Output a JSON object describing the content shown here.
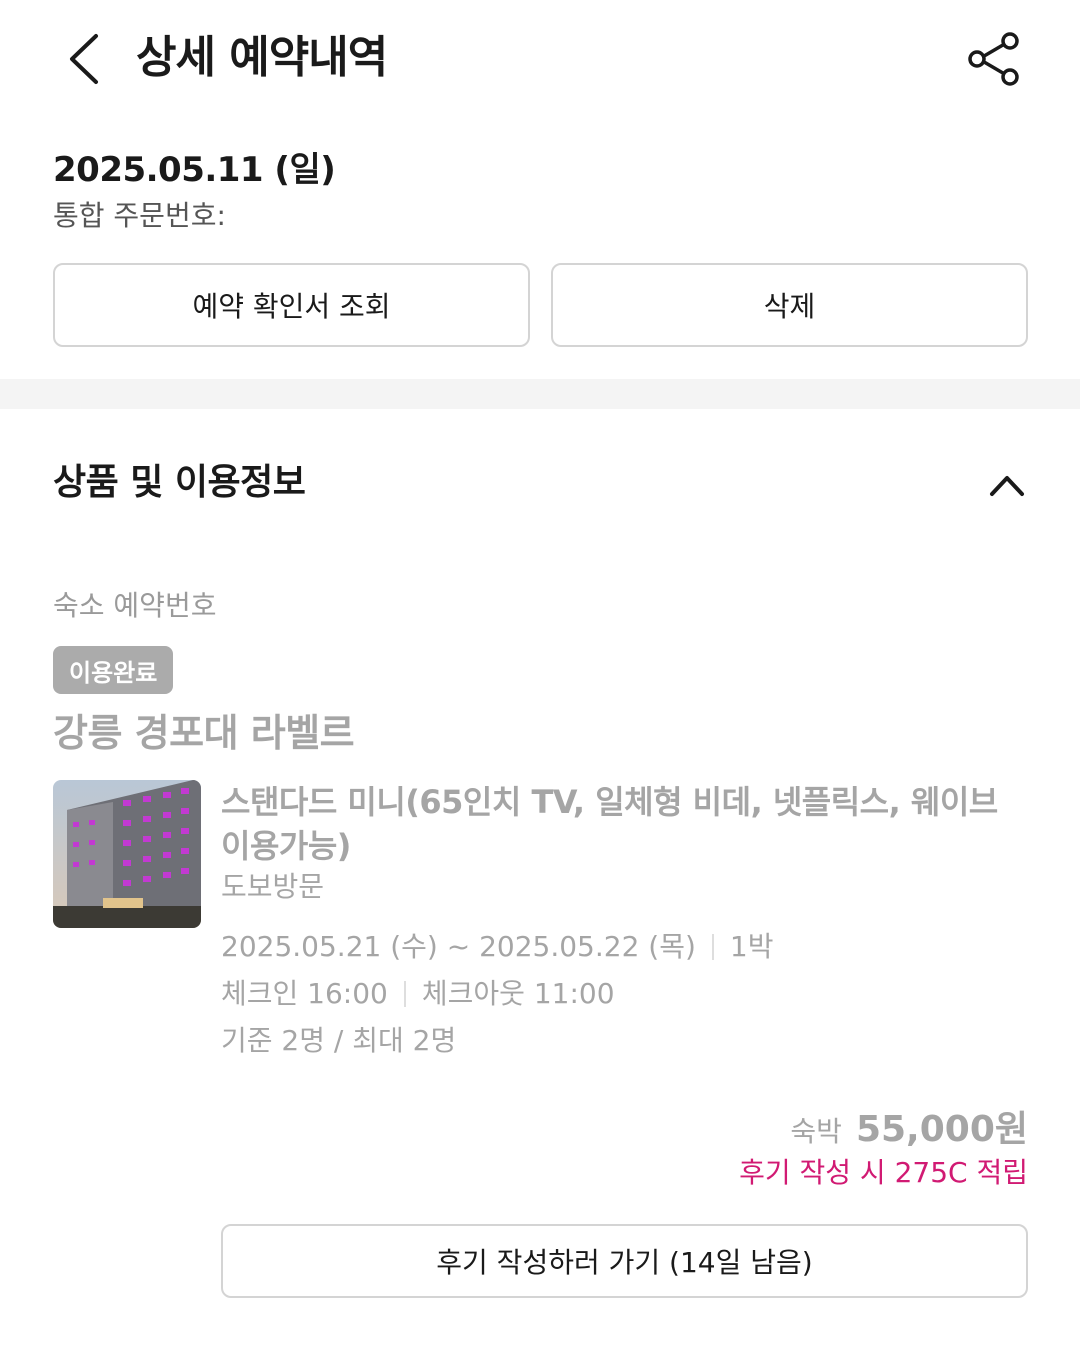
{
  "header": {
    "title": "상세 예약내역",
    "back_icon": "chevron-left-icon",
    "share_icon": "share-icon"
  },
  "order": {
    "date": "2025.05.11 (일)",
    "number_label": "통합 주문번호:",
    "confirm_button": "예약 확인서 조회",
    "delete_button": "삭제"
  },
  "section": {
    "title": "상품 및 이용정보",
    "collapse_icon": "chevron-up-icon"
  },
  "stay": {
    "reservation_label": "숙소 예약번호",
    "status": "이용완료",
    "hotel_name": "강릉 경포대 라벨르",
    "room_name": "스탠다드 미니(65인치 TV, 일체형 비데, 넷플릭스, 웨이브 이용가능)",
    "visit_type": "도보방문",
    "dates": "2025.05.21 (수) ~ 2025.05.22 (목)",
    "nights": "1박",
    "checkin": "체크인 16:00",
    "checkout": "체크아웃 11:00",
    "guests": "기준 2명 / 최대 2명",
    "price_label": "숙박",
    "price": "55,000원",
    "reward": "후기 작성 시 275C 적립",
    "review_button": "후기 작성하러 가기 (14일 남음)"
  },
  "colors": {
    "accent": "#d11a73",
    "muted": "#a5a5a5",
    "badge": "#ababab"
  }
}
